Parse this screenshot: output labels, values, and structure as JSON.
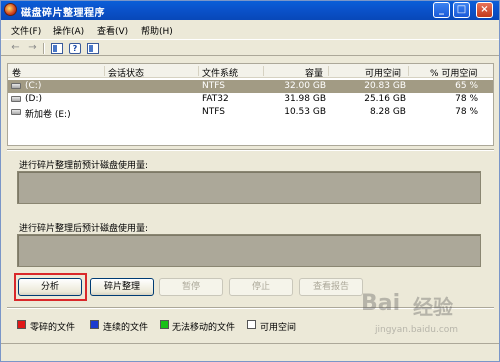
{
  "window": {
    "title": "磁盘碎片整理程序"
  },
  "caption_buttons": {
    "minimize": "_",
    "maximize": "□",
    "close": "×"
  },
  "menu": [
    "文件(F)",
    "操作(A)",
    "查看(V)",
    "帮助(H)"
  ],
  "toolbar": {
    "back": "←",
    "forward": "→",
    "help": "?"
  },
  "list": {
    "headers": [
      "卷",
      "会话状态",
      "文件系统",
      "容量",
      "可用空间",
      "% 可用空间"
    ],
    "rows": [
      {
        "volume": "(C:)",
        "status": "",
        "fs": "NTFS",
        "capacity": "32.00 GB",
        "free": "20.83 GB",
        "pct": "65 %",
        "selected": true
      },
      {
        "volume": "(D:)",
        "status": "",
        "fs": "FAT32",
        "capacity": "31.98 GB",
        "free": "25.16 GB",
        "pct": "78 %",
        "selected": false
      },
      {
        "volume": "新加卷 (E:)",
        "status": "",
        "fs": "NTFS",
        "capacity": "10.53 GB",
        "free": "8.28 GB",
        "pct": "78 %",
        "selected": false
      }
    ]
  },
  "usage": {
    "before_label": "进行碎片整理前预计磁盘使用量:",
    "after_label": "进行碎片整理后预计磁盘使用量:"
  },
  "buttons": {
    "analyze": "分析",
    "defrag": "碎片整理",
    "pause": "暂停",
    "stop": "停止",
    "report": "查看报告"
  },
  "legend": [
    {
      "label": "零碎的文件",
      "color": "#e01818"
    },
    {
      "label": "连续的文件",
      "color": "#1a3ad0"
    },
    {
      "label": "无法移动的文件",
      "color": "#18c018"
    },
    {
      "label": "可用空间",
      "color": "#ffffff"
    }
  ],
  "watermark": {
    "brand": "Bai",
    "brand2": "经验",
    "url": "jingyan.baidu.com"
  }
}
